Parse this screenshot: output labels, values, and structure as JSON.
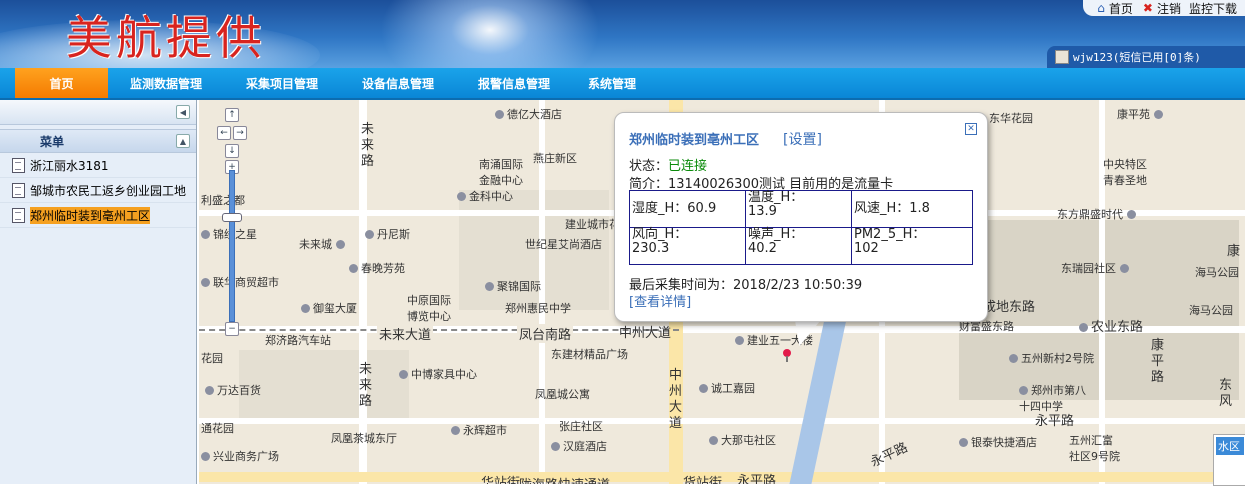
{
  "header": {
    "logo_text": "美航提供",
    "links": {
      "home": "首页",
      "logout": "注销",
      "monitor_download": "监控下载"
    },
    "user_info": "wjw123(短信已用[0]条)"
  },
  "nav": {
    "items": [
      "首页",
      "监测数据管理",
      "采集项目管理",
      "设备信息管理",
      "报警信息管理",
      "系统管理"
    ],
    "active": "首页"
  },
  "sidebar": {
    "menu_title": "菜单",
    "items": [
      "浙江丽水3181",
      "邹城市农民工返乡创业园工地",
      "郑州临时装到亳州工区"
    ],
    "selected": "郑州临时装到亳州工区"
  },
  "popup": {
    "title": "郑州临时装到亳州工区",
    "settings_link": "[设置]",
    "status_label": "状态：",
    "status_value": "已连接",
    "description": "简介：13140026300测试 目前用的是流量卡",
    "readings": [
      [
        "湿度_H：60.9",
        "温度_H：\n13.9",
        "风速_H：1.8"
      ],
      [
        "风向_H：\n230.3",
        "噪声_H：\n40.2",
        "PM2_5_H：\n102"
      ]
    ],
    "last_collect": "最后采集时间为：2018/2/23 10:50:39",
    "detail_link": "[查看详情]"
  },
  "map": {
    "labels": {
      "dezhi": "德亿大酒店",
      "weilai1": "未\n来\n路",
      "nanjiao": "南涌国际\n金融中心",
      "yanzhuang": "燕庄新区",
      "jinke": "金科中心",
      "lisheng": "利盛之都",
      "jinjing": "锦绣之星",
      "danni": "丹尼斯",
      "jianyecheng": "建业城市花园",
      "shiji": "世纪星艾尚酒店",
      "weilaicheng": "未来城",
      "chunwan": "春晚芳苑",
      "juhua": "聚锦国际",
      "lianhua": "联华商贸超市",
      "zhengzhouhui": "郑州惠民中学",
      "yuxi": "御玺大厦",
      "zhongyuan": "中原国际\n博览中心",
      "weilaidadao": "未来大道",
      "fengtai": "凤台南路",
      "zhongzhoudadao": "中州大道",
      "zhengji": "郑济路汽车站",
      "huayuan": "花园",
      "jianzhai": "建业五一大楼",
      "dongjian": "东建材精品广场",
      "zhongbo": "中博家具中心",
      "weilai2": "未\n来\n路",
      "wanda": "万达百货",
      "fenghuang": "凤凰城公寓",
      "chenggong": "诚工嘉园",
      "tongyuan": "通花园",
      "zhouyu": "州大道",
      "yonghui": "永辉超市",
      "zhangzhuang": "张庄社区",
      "dapeng": "大那屯社区",
      "fenghuangcheng": "凤凰茶城东厅",
      "hanting": "汉庭酒店",
      "xingye": "兴业商务广场",
      "yongpinglu": "永平路",
      "kuaiyu": "快速路",
      "chengdong": "成地东路",
      "yinxiang": "银泰快捷酒店",
      "wuzhou": "五州新村2号院",
      "zhongzhou8": "郑州市第八\n十四中学",
      "yongping2": "永平路",
      "wuzhouhui": "五州汇富\n社区9号院",
      "donghua": "东华花园",
      "yangguang": "阳光花园",
      "kangping": "康平苑",
      "zhongyang": "中央特区\n青春圣地",
      "dongfang": "东方鼎盛时代",
      "dongrui": "东瑞园社区",
      "haima": "海马公园",
      "haimagongyuan": "海马公园",
      "kang": "康",
      "nongye": "农业东路",
      "caiyuan": "财富盛东路",
      "dongfeng": "东\n风",
      "kangping2": "康\n平\n路",
      "shuiqu": "水区",
      "yongpinglu2": "永平路",
      "huazhan": "华站街",
      "kuaisu": "陇海路快速通道",
      "jinshan": "货站街",
      "yongping3": "永平路",
      "shangzhou": "中\n州\n大\n道"
    },
    "water_button": "水区"
  }
}
